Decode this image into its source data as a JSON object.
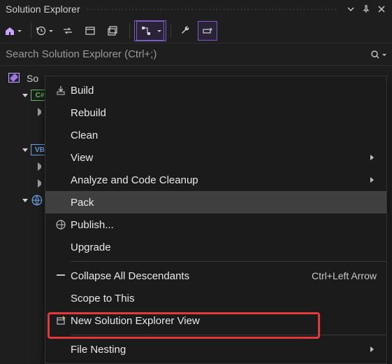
{
  "titlebar": {
    "title": "Solution Explorer"
  },
  "search": {
    "placeholder": "Search Solution Explorer (Ctrl+;)"
  },
  "tree": {
    "solution_label": "So",
    "cs_badge": "C#",
    "vb_badge": "VB"
  },
  "menu": {
    "build": "Build",
    "rebuild": "Rebuild",
    "clean": "Clean",
    "view": "View",
    "analyze": "Analyze and Code Cleanup",
    "pack": "Pack",
    "publish": "Publish...",
    "upgrade": "Upgrade",
    "collapse": "Collapse All Descendants",
    "collapse_shortcut": "Ctrl+Left Arrow",
    "scope": "Scope to This",
    "newview": "New Solution Explorer View",
    "nesting": "File Nesting"
  }
}
